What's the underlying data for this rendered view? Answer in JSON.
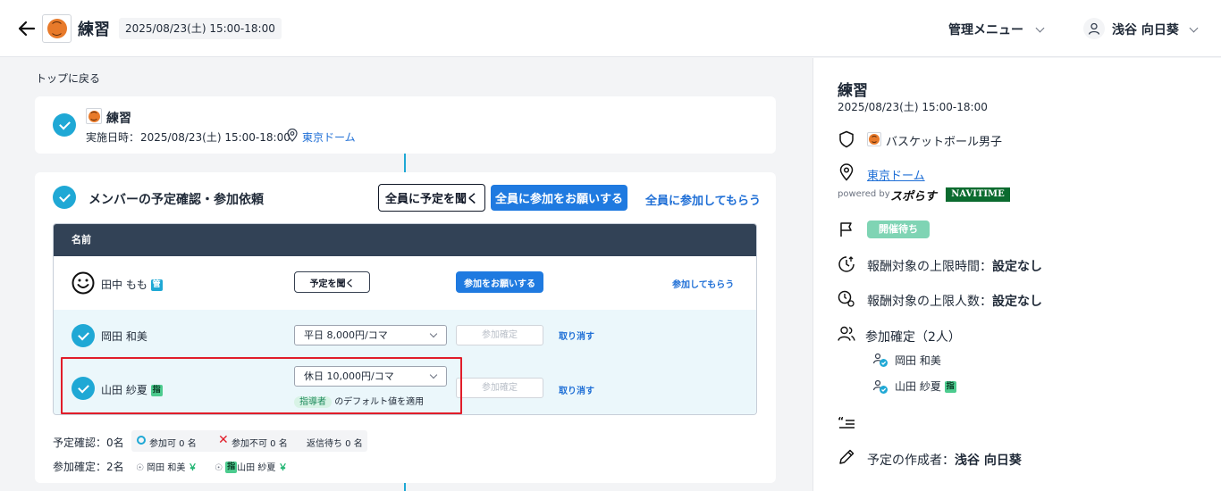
{
  "header": {
    "title": "練習",
    "datetime": "2025/08/23(土)  15:00-18:00",
    "admin_menu": "管理メニュー",
    "user_name": "浅谷 向日葵"
  },
  "main": {
    "back_to_top": "トップに戻る",
    "event_card": {
      "title": "練習",
      "date_label": "実施日時：",
      "date_value": "2025/08/23(土) 15:00-18:00",
      "location": "東京ドーム"
    },
    "member_card": {
      "title": "メンバーの予定確認・参加依頼",
      "ask_all": "全員に予定を聞く",
      "request_all": "全員に参加をお願いする",
      "join_all": "全員に参加してもらう",
      "table_header_name": "名前",
      "rows": [
        {
          "name": "田中 もも",
          "badge": "管",
          "ask": "予定を聞く",
          "request": "参加をお願いする",
          "join": "参加してもらう"
        },
        {
          "name": "岡田 和美",
          "rate": "平日  8,000円/コマ",
          "confirm": "参加確定",
          "cancel": "取り消す"
        },
        {
          "name": "山田 紗夏",
          "badge": "指",
          "rate": "休日  10,000円/コマ",
          "confirm": "参加確定",
          "cancel": "取り消す",
          "default_tag": "指導者",
          "default_text": "のデフォルト値を適用"
        }
      ],
      "summary": {
        "schedule_label": "予定確認：0名",
        "available": "参加可 0 名",
        "unavailable": "参加不可 0 名",
        "waiting": "返信待ち 0 名",
        "confirmed_label": "参加確定：2名",
        "confirmed_members": [
          "岡田 和美",
          "山田 紗夏"
        ],
        "confirmed_badge": "指",
        "yen": "￥"
      }
    }
  },
  "sidebar": {
    "title": "練習",
    "datetime": "2025/08/23(土) 15:00-18:00",
    "team": "バスケットボール男子",
    "location": "東京ドーム",
    "powered_by": "powered by",
    "brand1": "スポらす",
    "brand2": "NAVITIME",
    "status": "開催待ち",
    "limit_time_label": "報酬対象の上限時間：",
    "limit_time_value": "設定なし",
    "limit_people_label": "報酬対象の上限人数：",
    "limit_people_value": "設定なし",
    "confirmed_title": "参加確定（2人）",
    "confirmed_members": [
      "岡田 和美",
      "山田 紗夏"
    ],
    "member_badge": "指",
    "creator_label": "予定の作成者：",
    "creator_value": "浅谷 向日葵"
  },
  "colors": {
    "accent": "#1fa8d5",
    "primary": "#1f7ae0",
    "header_dark": "#324256",
    "highlight_red": "#e11d2a",
    "status_green": "#7fd4b4"
  }
}
